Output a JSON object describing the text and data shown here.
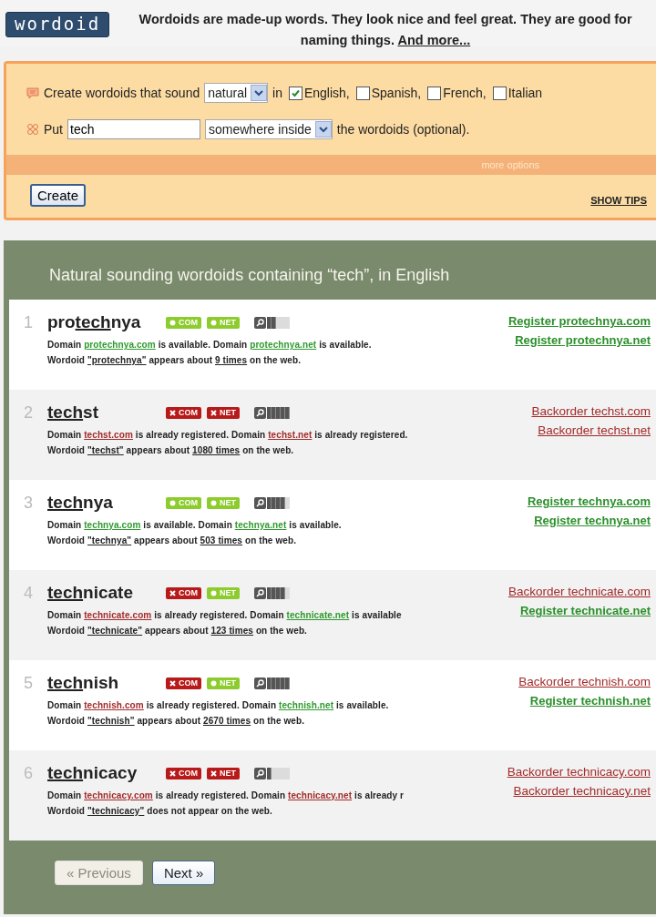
{
  "header": {
    "logo": "wordoid",
    "tagline": "Wordoids are made-up words. They look nice and feel great. They are good for naming things.",
    "more_link": "And more..."
  },
  "form": {
    "line1_label": "Create wordoids that sound",
    "sound_select": "natural",
    "in_label": "in",
    "languages": [
      {
        "label": "English,",
        "checked": true
      },
      {
        "label": "Spanish,",
        "checked": false
      },
      {
        "label": "French,",
        "checked": false
      },
      {
        "label": "Italian",
        "checked": false
      }
    ],
    "line2_label": "Put",
    "text_value": "tech",
    "position_select": "somewhere inside",
    "line2_suffix": "the wordoids (optional).",
    "more_options": "more options",
    "create_button": "Create",
    "show_tips": "SHOW TIPS"
  },
  "results": {
    "title": "Natural sounding wordoids containing “tech”, in English",
    "items": [
      {
        "number": "1",
        "word": [
          {
            "text": "pro",
            "highlight": false
          },
          {
            "text": "tech",
            "highlight": true
          },
          {
            "text": "nya",
            "highlight": false
          }
        ],
        "badges": [
          {
            "label": "COM",
            "available": true
          },
          {
            "label": "NET",
            "available": true
          }
        ],
        "level": 0.4,
        "domain_line": [
          {
            "text": "Domain ",
            "kind": "text"
          },
          {
            "text": "protechnya.com",
            "kind": "link",
            "available": true
          },
          {
            "text": " is available. Domain ",
            "kind": "text"
          },
          {
            "text": "protechnya.net",
            "kind": "link",
            "available": true
          },
          {
            "text": " is available.",
            "kind": "text"
          }
        ],
        "web_line": [
          {
            "text": "Wordoid ",
            "kind": "text"
          },
          {
            "text": "\"protechnya\"",
            "kind": "quote"
          },
          {
            "text": " appears about ",
            "kind": "text"
          },
          {
            "text": "9 times",
            "kind": "quote"
          },
          {
            "text": " on the web.",
            "kind": "text"
          }
        ],
        "actions": [
          {
            "text": "Register protechnya.com",
            "available": true
          },
          {
            "text": "Register protechnya.net",
            "available": true
          }
        ]
      },
      {
        "number": "2",
        "word": [
          {
            "text": "tech",
            "highlight": true
          },
          {
            "text": "st",
            "highlight": false
          }
        ],
        "badges": [
          {
            "label": "COM",
            "available": false
          },
          {
            "label": "NET",
            "available": false
          }
        ],
        "level": 1,
        "domain_line": [
          {
            "text": "Domain ",
            "kind": "text"
          },
          {
            "text": "techst.com",
            "kind": "link",
            "available": false
          },
          {
            "text": " is already registered. Domain ",
            "kind": "text"
          },
          {
            "text": "techst.net",
            "kind": "link",
            "available": false
          },
          {
            "text": " is already registered.",
            "kind": "text"
          }
        ],
        "web_line": [
          {
            "text": "Wordoid ",
            "kind": "text"
          },
          {
            "text": "\"techst\"",
            "kind": "quote"
          },
          {
            "text": " appears about ",
            "kind": "text"
          },
          {
            "text": "1080 times",
            "kind": "quote"
          },
          {
            "text": " on the web.",
            "kind": "text"
          }
        ],
        "actions": [
          {
            "text": "Backorder techst.com",
            "available": false
          },
          {
            "text": "Backorder techst.net",
            "available": false
          }
        ]
      },
      {
        "number": "3",
        "word": [
          {
            "text": "tech",
            "highlight": true
          },
          {
            "text": "nya",
            "highlight": false
          }
        ],
        "badges": [
          {
            "label": "COM",
            "available": true
          },
          {
            "label": "NET",
            "available": true
          }
        ],
        "level": 0.8,
        "domain_line": [
          {
            "text": "Domain ",
            "kind": "text"
          },
          {
            "text": "technya.com",
            "kind": "link",
            "available": true
          },
          {
            "text": " is available. Domain ",
            "kind": "text"
          },
          {
            "text": "technya.net",
            "kind": "link",
            "available": true
          },
          {
            "text": " is available.",
            "kind": "text"
          }
        ],
        "web_line": [
          {
            "text": "Wordoid ",
            "kind": "text"
          },
          {
            "text": "\"technya\"",
            "kind": "quote"
          },
          {
            "text": " appears about ",
            "kind": "text"
          },
          {
            "text": "503 times",
            "kind": "quote"
          },
          {
            "text": " on the web.",
            "kind": "text"
          }
        ],
        "actions": [
          {
            "text": "Register technya.com",
            "available": true
          },
          {
            "text": "Register technya.net",
            "available": true
          }
        ]
      },
      {
        "number": "4",
        "word": [
          {
            "text": "tech",
            "highlight": true
          },
          {
            "text": "nicate",
            "highlight": false
          }
        ],
        "badges": [
          {
            "label": "COM",
            "available": false
          },
          {
            "label": "NET",
            "available": true
          }
        ],
        "level": 0.8,
        "domain_line": [
          {
            "text": "Domain ",
            "kind": "text"
          },
          {
            "text": "technicate.com",
            "kind": "link",
            "available": false
          },
          {
            "text": " is already registered. Domain ",
            "kind": "text"
          },
          {
            "text": "technicate.net",
            "kind": "link",
            "available": true
          },
          {
            "text": " is available",
            "kind": "text"
          }
        ],
        "web_line": [
          {
            "text": "Wordoid ",
            "kind": "text"
          },
          {
            "text": "\"technicate\"",
            "kind": "quote"
          },
          {
            "text": " appears about ",
            "kind": "text"
          },
          {
            "text": "123 times",
            "kind": "quote"
          },
          {
            "text": " on the web.",
            "kind": "text"
          }
        ],
        "actions": [
          {
            "text": "Backorder technicate.com",
            "available": false
          },
          {
            "text": "Register technicate.net",
            "available": true
          }
        ]
      },
      {
        "number": "5",
        "word": [
          {
            "text": "tech",
            "highlight": true
          },
          {
            "text": "nish",
            "highlight": false
          }
        ],
        "badges": [
          {
            "label": "COM",
            "available": false
          },
          {
            "label": "NET",
            "available": true
          }
        ],
        "level": 1,
        "domain_line": [
          {
            "text": "Domain ",
            "kind": "text"
          },
          {
            "text": "technish.com",
            "kind": "link",
            "available": false
          },
          {
            "text": " is already registered. Domain ",
            "kind": "text"
          },
          {
            "text": "technish.net",
            "kind": "link",
            "available": true
          },
          {
            "text": " is available.",
            "kind": "text"
          }
        ],
        "web_line": [
          {
            "text": "Wordoid ",
            "kind": "text"
          },
          {
            "text": "\"technish\"",
            "kind": "quote"
          },
          {
            "text": " appears about ",
            "kind": "text"
          },
          {
            "text": "2670 times",
            "kind": "quote"
          },
          {
            "text": " on the web.",
            "kind": "text"
          }
        ],
        "actions": [
          {
            "text": "Backorder technish.com",
            "available": false
          },
          {
            "text": "Register technish.net",
            "available": true
          }
        ]
      },
      {
        "number": "6",
        "word": [
          {
            "text": "tech",
            "highlight": true
          },
          {
            "text": "nicacy",
            "highlight": false
          }
        ],
        "badges": [
          {
            "label": "COM",
            "available": false
          },
          {
            "label": "NET",
            "available": false
          }
        ],
        "level": 0.2,
        "domain_line": [
          {
            "text": "Domain ",
            "kind": "text"
          },
          {
            "text": "technicacy.com",
            "kind": "link",
            "available": false
          },
          {
            "text": " is already registered. Domain ",
            "kind": "text"
          },
          {
            "text": "technicacy.net",
            "kind": "link",
            "available": false
          },
          {
            "text": " is already r",
            "kind": "text"
          }
        ],
        "web_line": [
          {
            "text": "Wordoid ",
            "kind": "text"
          },
          {
            "text": "\"technicacy\"",
            "kind": "quote"
          },
          {
            "text": " does not appear on the web.",
            "kind": "text"
          }
        ],
        "actions": [
          {
            "text": "Backorder technicacy.com",
            "available": false
          },
          {
            "text": "Backorder technicacy.net",
            "available": false
          }
        ]
      }
    ]
  },
  "pagination": {
    "previous": {
      "label": "« Previous",
      "disabled": true
    },
    "next": {
      "label": "Next »",
      "disabled": false
    }
  }
}
